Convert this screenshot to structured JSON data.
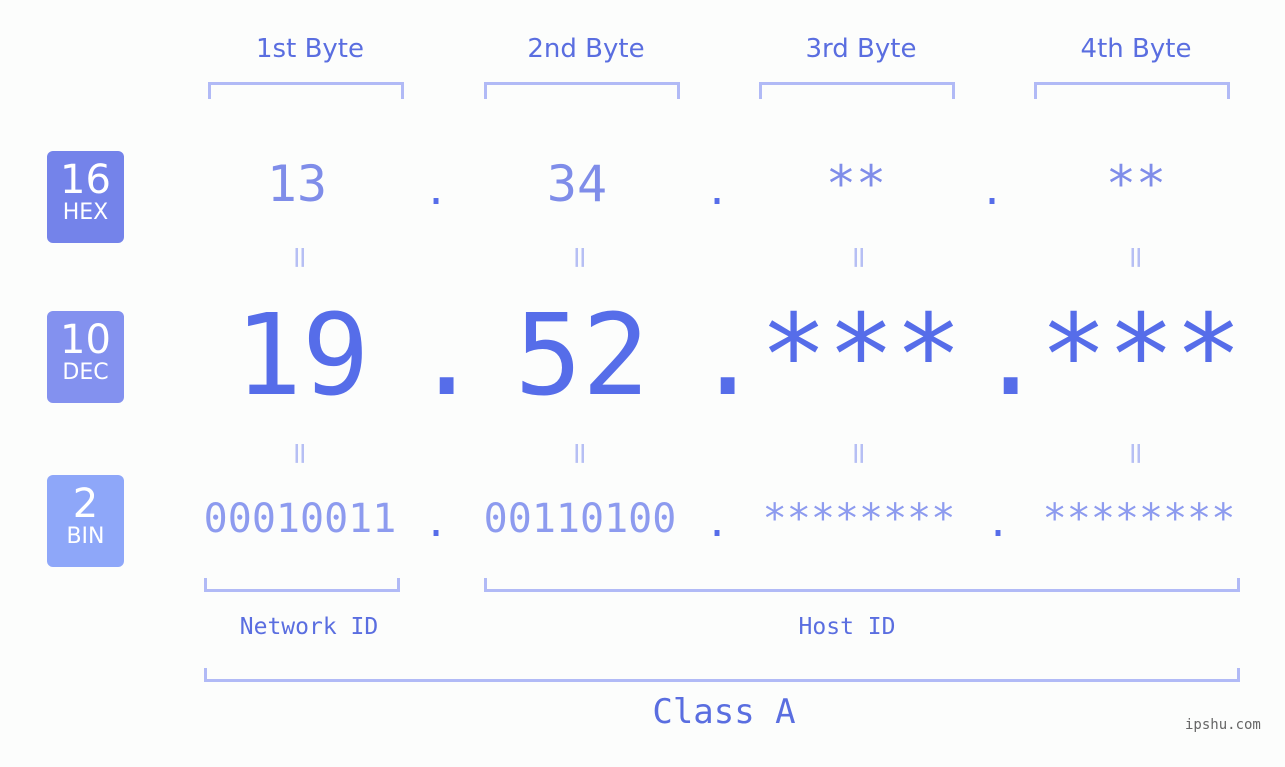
{
  "headers": [
    "1st Byte",
    "2nd Byte",
    "3rd Byte",
    "4th Byte"
  ],
  "badges": [
    {
      "num": "16",
      "label": "HEX",
      "color": "#7483ea"
    },
    {
      "num": "10",
      "label": "DEC",
      "color": "#8391ef"
    },
    {
      "num": "2",
      "label": "BIN",
      "color": "#8ea7f9"
    }
  ],
  "hex": [
    "13",
    "34",
    "**",
    "**"
  ],
  "dec": [
    "19",
    "52",
    "***",
    "***"
  ],
  "bin": [
    "00010011",
    "00110100",
    "********",
    "********"
  ],
  "separator": ".",
  "equals": "=",
  "network_id": "Network ID",
  "host_id": "Host ID",
  "class_label": "Class A",
  "watermark": "ipshu.com"
}
